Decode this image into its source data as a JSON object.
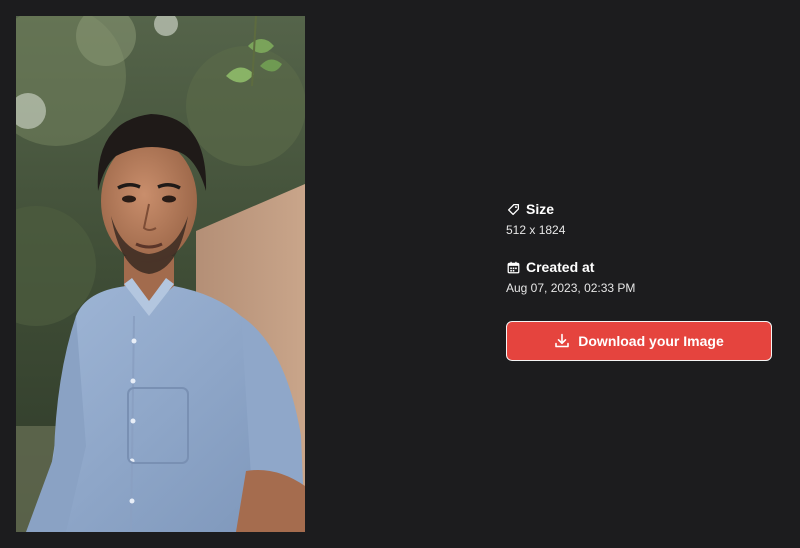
{
  "image": {
    "alt": "Generated portrait image"
  },
  "details": {
    "size": {
      "label": "Size",
      "value": "512 x 1824",
      "icon": "tag-icon"
    },
    "created": {
      "label": "Created at",
      "value": "Aug 07, 2023, 02:33 PM",
      "icon": "calendar-icon"
    }
  },
  "actions": {
    "download_label": "Download your Image",
    "download_icon": "download-icon"
  },
  "colors": {
    "background": "#1c1c1e",
    "accent": "#e5443e",
    "text": "#ffffff"
  }
}
